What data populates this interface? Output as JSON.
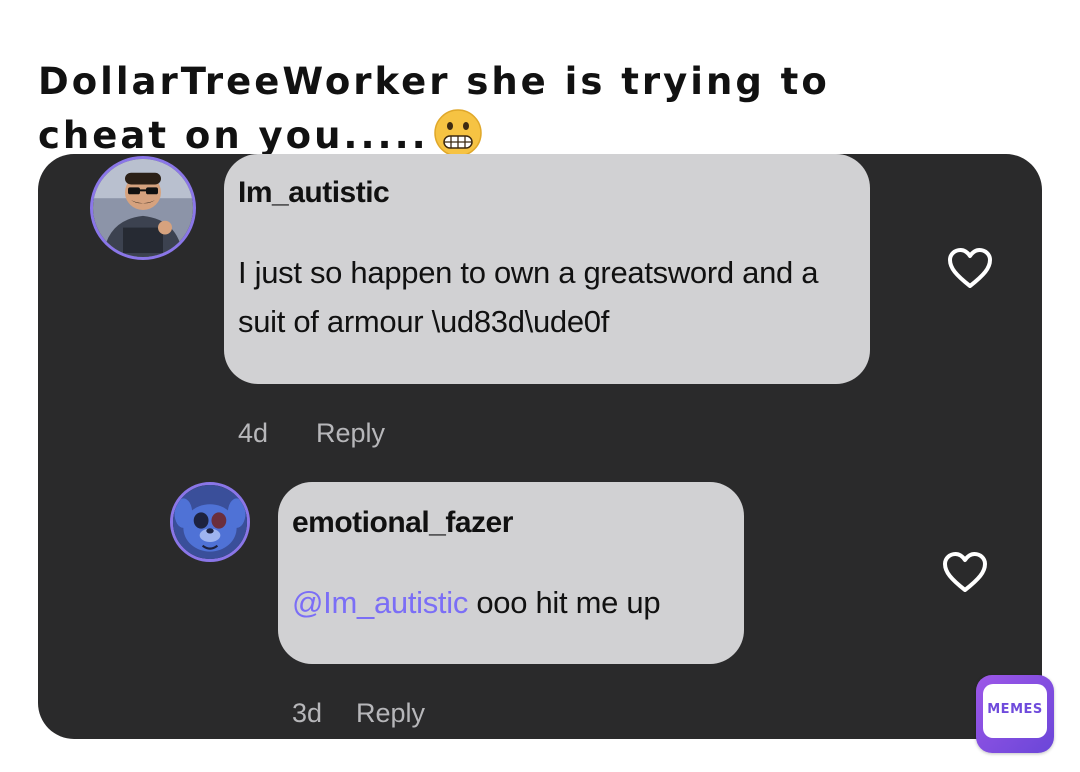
{
  "caption": {
    "text": "DollarTreeWorker she is trying to cheat on you.....",
    "emoji": "grimacing-face"
  },
  "comments": [
    {
      "username": "Im_autistic",
      "body": "I just so happen to own a greatsword and a suit of armour \\ud83d\\ude0f",
      "age": "4d",
      "reply_label": "Reply",
      "avatar": "soldier-avatar",
      "liked": false
    },
    {
      "username": "emotional_fazer",
      "mention": "@Im_autistic",
      "body": " ooo hit me up",
      "age": "3d",
      "reply_label": "Reply",
      "avatar": "blue-creature-avatar",
      "liked": false
    }
  ],
  "watermark": {
    "text": "MEMES"
  },
  "colors": {
    "panel_bg": "#2a2a2b",
    "bubble_bg": "#d1d1d3",
    "mention": "#7b6ef6",
    "meta_text": "#b7b7ba",
    "avatar_ring": "#8a76e8"
  }
}
